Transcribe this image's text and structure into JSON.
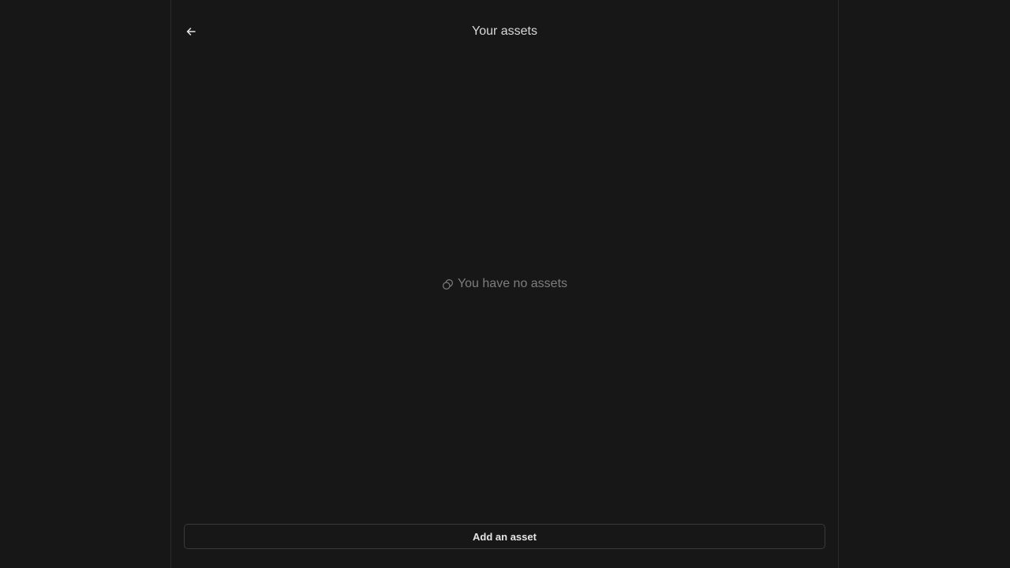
{
  "header": {
    "title": "Your assets",
    "back_icon": "arrow-left-icon"
  },
  "empty_state": {
    "icon": "coins-icon",
    "message": "You have no assets"
  },
  "footer": {
    "add_button_label": "Add an asset"
  },
  "colors": {
    "background": "#171717",
    "border": "#2a2a2a",
    "title_text": "#d9d9d9",
    "muted_text": "#7d7d7d",
    "button_text": "#e6e6e6"
  }
}
